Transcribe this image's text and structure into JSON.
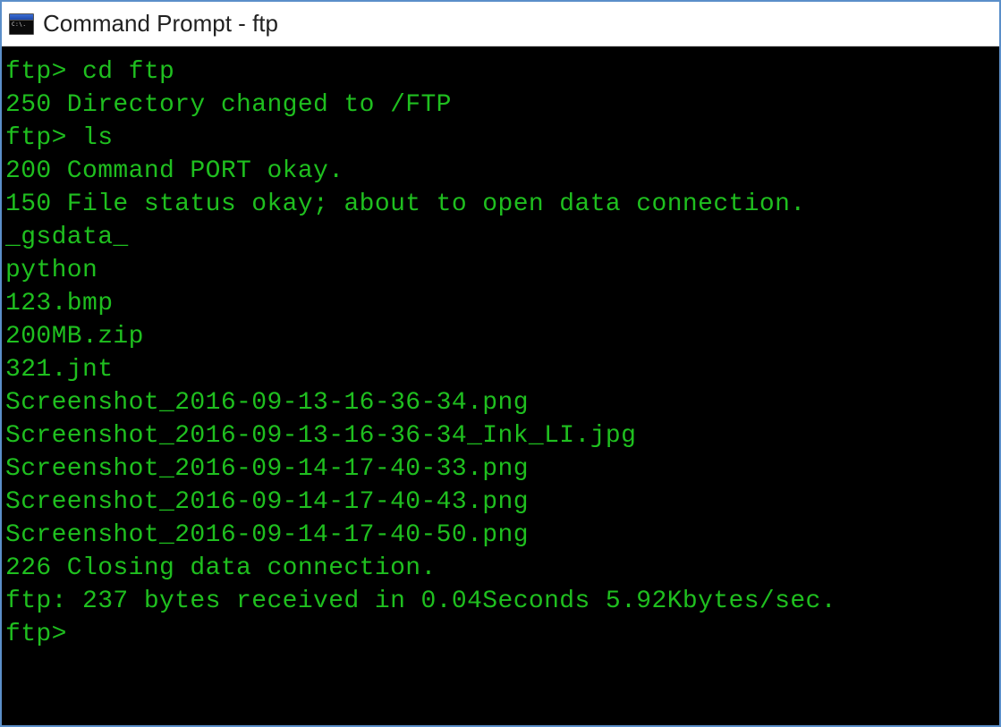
{
  "window": {
    "title": "Command Prompt - ftp",
    "icon_caption": "C:\\."
  },
  "terminal": {
    "lines": [
      "ftp> cd ftp",
      "250 Directory changed to /FTP",
      "ftp> ls",
      "200 Command PORT okay.",
      "150 File status okay; about to open data connection.",
      "_gsdata_",
      "python",
      "123.bmp",
      "200MB.zip",
      "321.jnt",
      "Screenshot_2016-09-13-16-36-34.png",
      "Screenshot_2016-09-13-16-36-34_Ink_LI.jpg",
      "Screenshot_2016-09-14-17-40-33.png",
      "Screenshot_2016-09-14-17-40-43.png",
      "Screenshot_2016-09-14-17-40-50.png",
      "226 Closing data connection.",
      "ftp: 237 bytes received in 0.04Seconds 5.92Kbytes/sec.",
      "ftp>"
    ]
  }
}
